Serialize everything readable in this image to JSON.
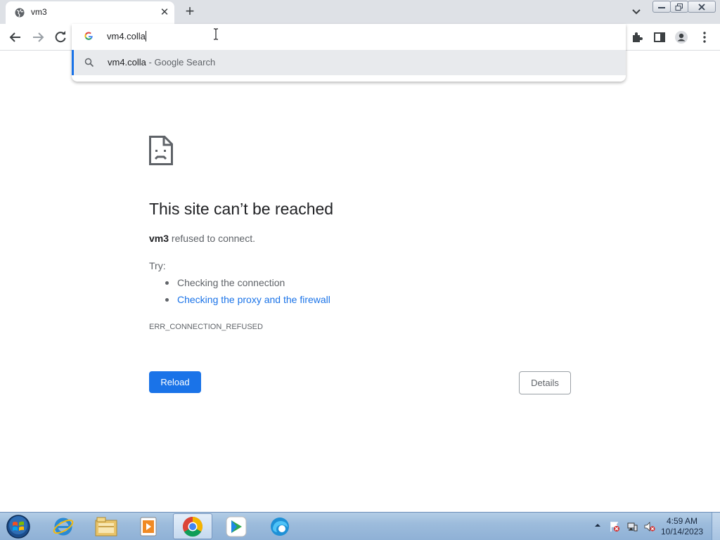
{
  "browser": {
    "tab": {
      "title": "vm3",
      "icon": "globe-icon"
    },
    "new_tab_icon": "plus-icon",
    "toolbar": {
      "back_icon": "back-arrow-icon",
      "forward_icon": "forward-arrow-icon",
      "reload_icon": "reload-icon",
      "extensions_icon": "puzzle-icon",
      "side_panel_icon": "side-panel-icon",
      "profile_icon": "avatar-icon",
      "menu_icon": "kebab-menu-icon"
    },
    "omnibox": {
      "value": "vm4.colla",
      "suggestion": {
        "query": "vm4.colla",
        "suffix": " - Google Search"
      }
    },
    "accent_color": "#1a73e8"
  },
  "error_page": {
    "icon": "sad-document-icon",
    "title": "This site can’t be reached",
    "host": "vm3",
    "message": " refused to connect.",
    "try_label": "Try:",
    "suggestions": [
      {
        "text": "Checking the connection",
        "link": false
      },
      {
        "text": "Checking the proxy and the firewall",
        "link": true
      }
    ],
    "error_code": "ERR_CONNECTION_REFUSED",
    "reload_label": "Reload",
    "details_label": "Details"
  },
  "taskbar": {
    "apps": [
      "internet-explorer-icon",
      "file-explorer-icon",
      "media-player-icon",
      "chrome-icon",
      "ssh-client-icon",
      "edge-icon"
    ],
    "active_app": "chrome-icon",
    "clock": {
      "time": "4:59 AM",
      "date": "10/14/2023"
    }
  }
}
